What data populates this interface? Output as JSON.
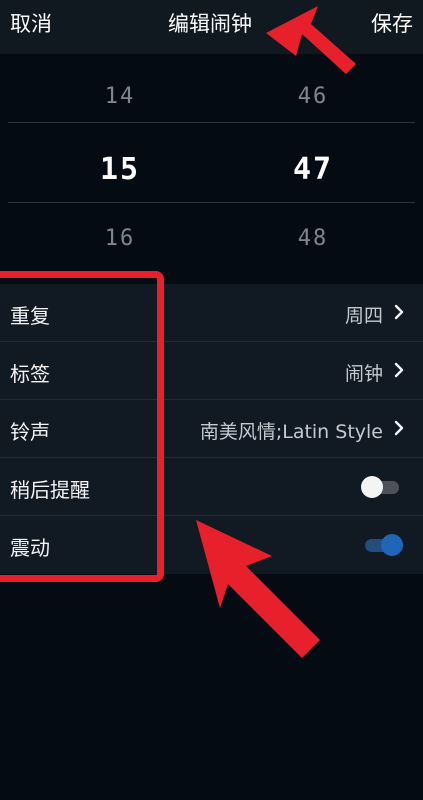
{
  "header": {
    "cancel_label": "取消",
    "title": "编辑闹钟",
    "save_label": "保存"
  },
  "picker": {
    "hours": [
      "14",
      "15",
      "16"
    ],
    "minutes": [
      "46",
      "47",
      "48"
    ]
  },
  "settings": {
    "repeat": {
      "label": "重复",
      "value": "周四"
    },
    "tag": {
      "label": "标签",
      "value": "闹钟"
    },
    "ringtone": {
      "label": "铃声",
      "value": "南美风情;Latin Style"
    },
    "snooze": {
      "label": "稍后提醒",
      "enabled": false
    },
    "vibrate": {
      "label": "震动",
      "enabled": true
    }
  },
  "colors": {
    "background": "#050b12",
    "panel": "#111922",
    "toggle_on": "#1f66b8",
    "annotation": "#e8202c"
  },
  "icons": [
    "chevron-right-icon",
    "toggle-switch",
    "arrow-annotation"
  ]
}
